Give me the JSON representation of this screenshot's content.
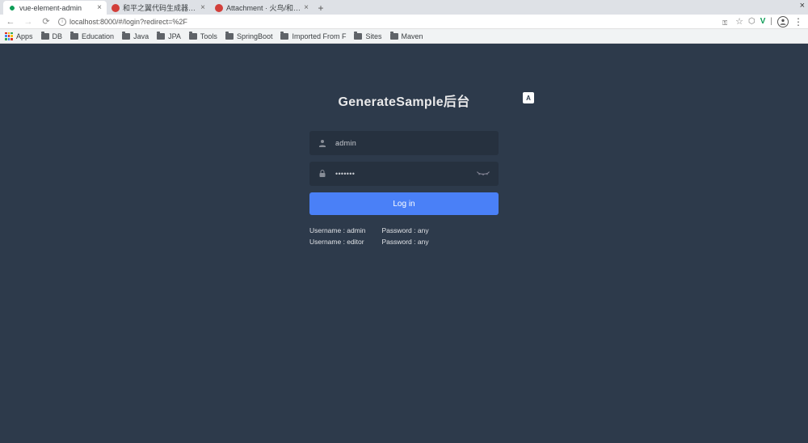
{
  "browser": {
    "tabs": [
      {
        "title": "vue-element-admin",
        "favicon": "green",
        "active": true
      },
      {
        "title": "和平之翼代码生成器SME…",
        "favicon": "red",
        "active": false
      },
      {
        "title": "Attachment · 火鸟/和平之…",
        "favicon": "red",
        "active": false
      }
    ],
    "url": "localhost:8000/#/login?redirect=%2F",
    "bookmarks": [
      "Apps",
      "DB",
      "Education",
      "Java",
      "JPA",
      "Tools",
      "SpringBoot",
      "Imported From F",
      "Sites",
      "Maven"
    ]
  },
  "login": {
    "title": "GenerateSample后台",
    "username_value": "admin",
    "password_value": "•••••••",
    "button_label": "Log in",
    "lang_label": "A",
    "hints": {
      "admin_user": "Username : admin",
      "admin_pass": "Password : any",
      "editor_user": "Username : editor",
      "editor_pass": "Password : any"
    }
  }
}
